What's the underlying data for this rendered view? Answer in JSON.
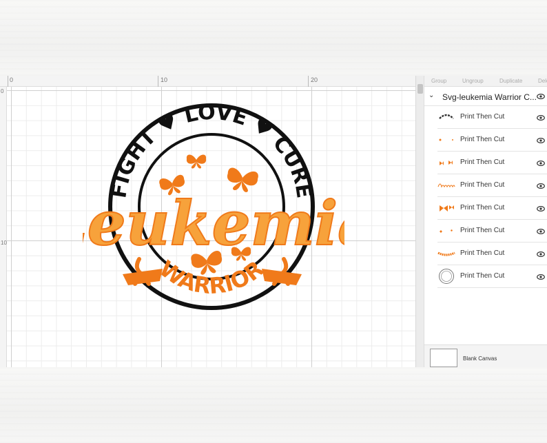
{
  "canvas": {
    "ruler_top": [
      "0",
      "10",
      "20"
    ],
    "ruler_left": [
      "0",
      "10"
    ]
  },
  "design": {
    "arc_top_text": "FIGHT ♥ LOVE ♥ CURE",
    "words_top": [
      "FIGHT",
      "LOVE",
      "CURE"
    ],
    "main_script": "Leukemia",
    "bottom_text": "WARRIOR",
    "colors": {
      "orange": "#f07a1a",
      "orange_light": "#f7a23b",
      "black": "#111111"
    }
  },
  "panel": {
    "tabs": [
      "Group",
      "Ungroup",
      "Duplicate",
      "Dele"
    ],
    "group_title": "Svg-leukemia Warrior C...",
    "layers": [
      {
        "label": "Print Then Cut",
        "icon": "arc-text-thumb"
      },
      {
        "label": "Print Then Cut",
        "icon": "dots-thumb"
      },
      {
        "label": "Print Then Cut",
        "icon": "butterflies-thumb"
      },
      {
        "label": "Print Then Cut",
        "icon": "leukemia-script-thumb"
      },
      {
        "label": "Print Then Cut",
        "icon": "butterfly-pair-thumb"
      },
      {
        "label": "Print Then Cut",
        "icon": "hearts-thumb"
      },
      {
        "label": "Print Then Cut",
        "icon": "warrior-ribbon-thumb"
      },
      {
        "label": "Print Then Cut",
        "icon": "circle-frame-thumb"
      }
    ],
    "footer_label": "Blank Canvas"
  }
}
